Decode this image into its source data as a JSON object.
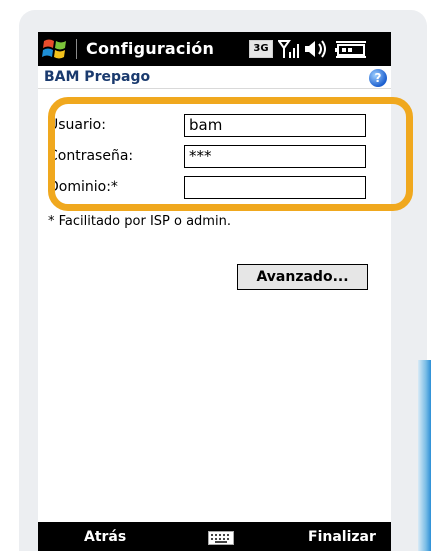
{
  "statusbar": {
    "title": "Configuración",
    "network": "3G"
  },
  "subheader": {
    "title": "BAM Prepago",
    "help": "?"
  },
  "form": {
    "user_label": "Usuario:",
    "user_value": "bam",
    "password_label": "Contraseña:",
    "password_value": "***",
    "domain_label": "Dominio:*",
    "domain_value": ""
  },
  "note": "* Facilitado por ISP o admin.",
  "advanced_button": "Avanzado...",
  "softkeys": {
    "left": "Atrás",
    "right": "Finalizar"
  },
  "colors": {
    "highlight": "#f0a81e",
    "titlebar": "#000000"
  }
}
